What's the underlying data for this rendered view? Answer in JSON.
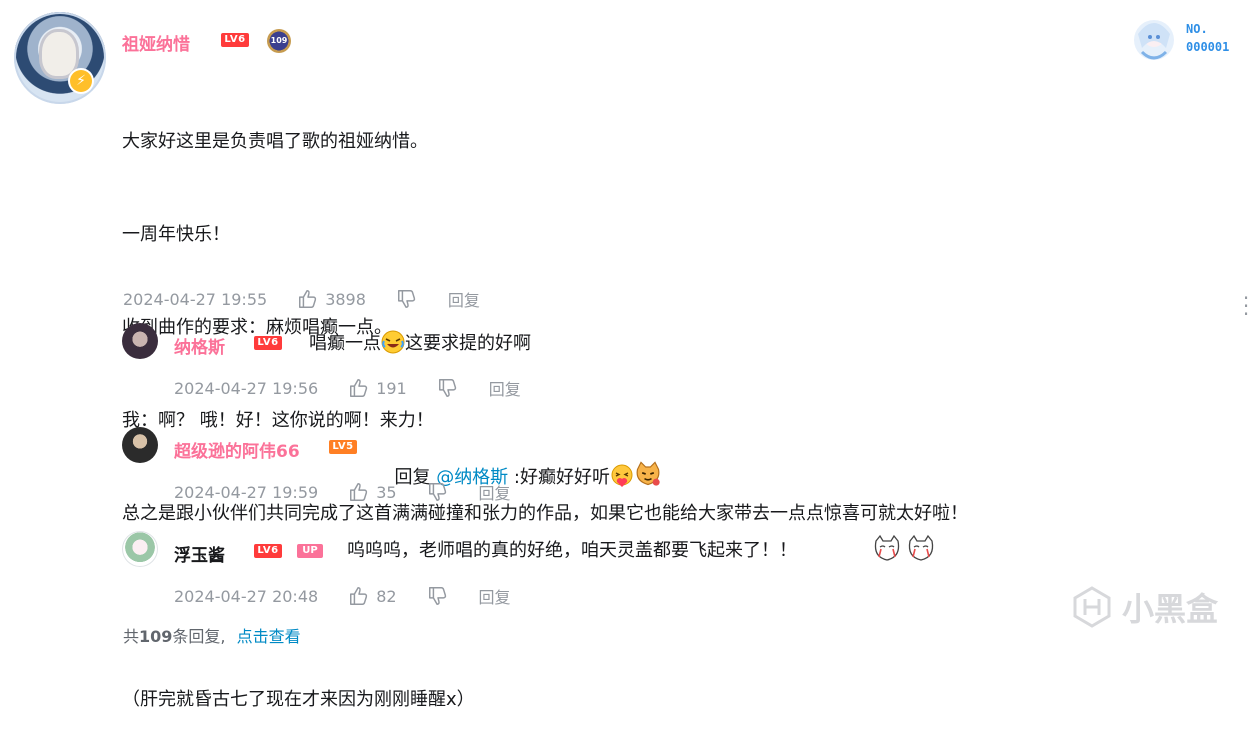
{
  "main_comment": {
    "username": "祖娅纳惜",
    "level": "LV6",
    "medal": "109",
    "lines": [
      "大家好这里是负责唱了歌的祖娅纳惜。",
      "一周年快乐！",
      "收到曲作的要求：麻烦唱癫一点。",
      "我：啊？ 哦！好！这你说的啊！来力！",
      "总之是跟小伙伴们共同完成了这首满满碰撞和张力的作品，如果它也能给大家带去一点点惊喜可就太好啦！",
      "",
      "（肝完就昏古七了现在才来因为刚刚睡醒x）"
    ],
    "time": "2024-04-27 19:55",
    "likes": "3898",
    "reply_label": "回复"
  },
  "badge": {
    "no_label": "NO.",
    "no_value": "000001"
  },
  "replies": [
    {
      "username": "纳格斯",
      "level": "LV6",
      "text_before": "唱癫一点",
      "text_after": "这要求提的好啊",
      "time": "2024-04-27 19:56",
      "likes": "191",
      "reply_label": "回复"
    },
    {
      "username": "超级逊的阿伟66",
      "level": "LV5",
      "reply_prefix": "回复 ",
      "mention": "@纳格斯",
      "text": " :好癫好好听",
      "time": "2024-04-27 19:59",
      "likes": "35",
      "reply_label": "回复"
    },
    {
      "username": "浮玉酱",
      "level": "LV6",
      "up_badge": "UP",
      "text": "呜呜呜，老师唱的真的好绝，咱天灵盖都要飞起来了！！",
      "time": "2024-04-27 20:48",
      "likes": "82",
      "reply_label": "回复"
    }
  ],
  "footer": {
    "total_prefix": "共",
    "total_count": "109",
    "total_suffix": "条回复,",
    "view_link": "点击查看"
  },
  "watermark": "小黑盒",
  "colors": {
    "username": "#fb7299",
    "meta": "#9499a0",
    "link": "#008ac5",
    "level_red": "#ff3b3b",
    "level_orange": "#ff7f24"
  }
}
